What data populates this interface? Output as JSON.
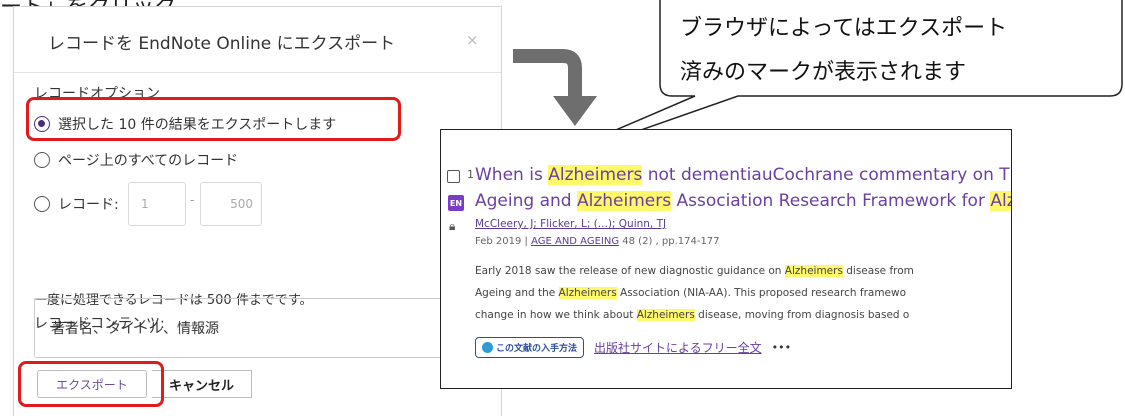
{
  "top_line": "ート」をクリック。",
  "dialog": {
    "title": "レコードを EndNote Online にエクスポート",
    "close_label": "×",
    "record_options_label": "レコードオプション",
    "option_selected": "選択した 10 件の結果をエクスポートします",
    "option_page": "ページ上のすべてのレコード",
    "option_range": "レコード:",
    "range_from": "1",
    "range_dash": "-",
    "range_to": "500",
    "limit_note": "一度に処理できるレコードは 500 件までです。",
    "content_label": "レコードコンテンツ:",
    "content_selected": "著者名、タイトル、情報源",
    "export_button": "エクスポート",
    "cancel_button": "キャンセル"
  },
  "callout": {
    "line1": "ブラウザによってはエクスポート",
    "line2": "済みのマークが表示されます"
  },
  "result": {
    "number": "1",
    "badge": "EN",
    "title_line1_a": "When is ",
    "title_line1_hl": "Alzheimers",
    "title_line1_b": " not dementiauCochrane commentary on Th",
    "title_line2_a": "Ageing and ",
    "title_line2_hl1": "Alzheimers",
    "title_line2_b": " Association Research Framework for ",
    "title_line2_hl2": "Alzh",
    "authors": "McCleery, J; Flicker, L; (...); Quinn, TJ",
    "date": "Feb 2019 | ",
    "source": "AGE AND AGEING",
    "volume": " 48 (2) , pp.174-177",
    "abs1_a": "Early 2018 saw the release of new diagnostic guidance on ",
    "abs1_hl": "Alzheimers",
    "abs1_b": " disease from",
    "abs2_a": "Ageing and the ",
    "abs2_hl": "Alzheimers",
    "abs2_b": " Association (NIA-AA). This proposed research framewo",
    "abs3_a": "change in how we think about ",
    "abs3_hl": "Alzheimers",
    "abs3_b": " disease, moving from diagnosis based o",
    "findit": "この文献の入手方法",
    "free_link": "出版社サイトによるフリー全文",
    "more": "•••"
  },
  "colors": {
    "highlight_box": "#e11b1b",
    "arrow": "#6e6e6e",
    "title_link": "#6b3fa0",
    "badge": "#7b3cc7",
    "text_highlight": "#fff86b"
  },
  "icons": {
    "close": "close-icon",
    "arrow": "curved-down-arrow-icon",
    "lock": "lock-icon",
    "findit_logo": "globe-icon",
    "select_chevron": "chevron-down-icon"
  }
}
